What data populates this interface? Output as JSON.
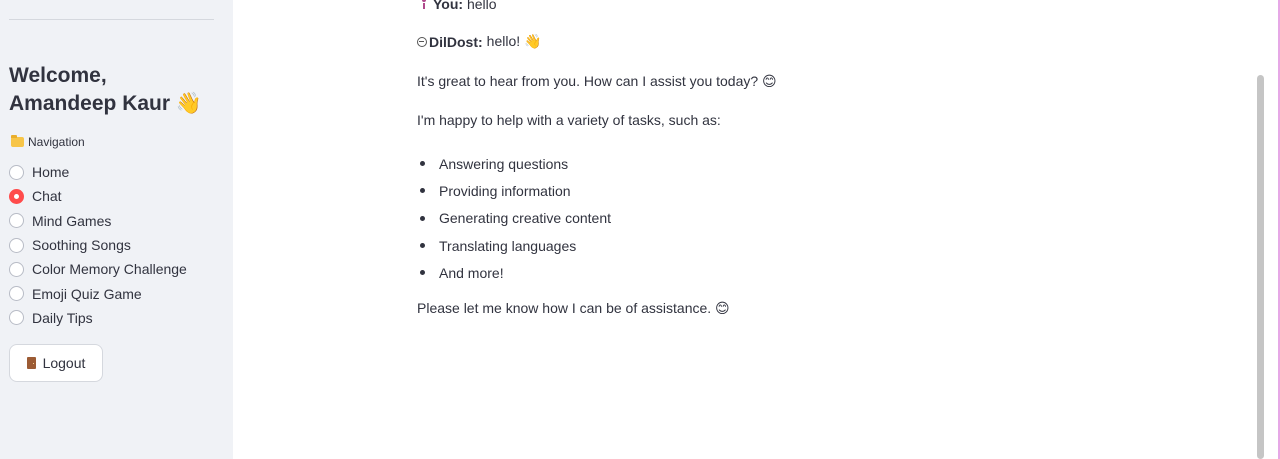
{
  "sidebar": {
    "welcome_line1": "Welcome,",
    "welcome_line2": "Amandeep Kaur 👋",
    "nav_label": "Navigation",
    "nav_icon": "folder-icon",
    "items": [
      {
        "label": "Home",
        "selected": false
      },
      {
        "label": "Chat",
        "selected": true
      },
      {
        "label": "Mind Games",
        "selected": false
      },
      {
        "label": "Soothing Songs",
        "selected": false
      },
      {
        "label": "Color Memory Challenge",
        "selected": false
      },
      {
        "label": "Emoji Quiz Game",
        "selected": false
      },
      {
        "label": "Daily Tips",
        "selected": false
      }
    ],
    "logout_label": "Logout",
    "logout_icon": "door-icon",
    "accent_color": "#ff4b4b"
  },
  "chat": {
    "user_name": "You:",
    "user_text": "hello",
    "bot_name": "DilDost:",
    "bot_greeting": "hello! 👋",
    "para1": "It's great to hear from you. How can I assist you today? 😊",
    "para2": "I'm happy to help with a variety of tasks, such as:",
    "bullets": [
      "Answering questions",
      "Providing information",
      "Generating creative content",
      "Translating languages",
      "And more!"
    ],
    "para3": "Please let me know how I can be of assistance. 😊"
  }
}
